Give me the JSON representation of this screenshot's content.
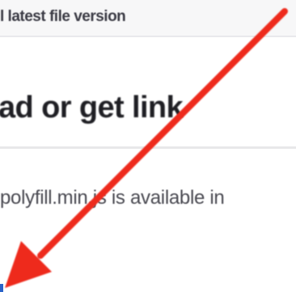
{
  "top_bar": {
    "text": "l latest file version"
  },
  "section": {
    "heading": "ad or get link",
    "body": "polyfill.min.js is available in"
  },
  "colors": {
    "arrow": "#ee2a1f",
    "top_bar_bg": "#f7f7f8",
    "divider": "#e8e8ea",
    "marker": "#2a63c8"
  }
}
